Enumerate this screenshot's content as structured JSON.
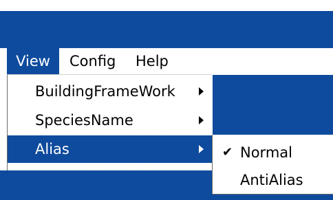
{
  "menubar": {
    "items": [
      {
        "label": "View",
        "active": true
      },
      {
        "label": "Config",
        "active": false
      },
      {
        "label": "Help",
        "active": false
      }
    ]
  },
  "view_menu": {
    "items": [
      {
        "label": "BuildingFrameWork",
        "has_submenu": true,
        "selected": false
      },
      {
        "label": "SpeciesName",
        "has_submenu": true,
        "selected": false
      },
      {
        "label": "Alias",
        "has_submenu": true,
        "selected": true
      }
    ]
  },
  "alias_submenu": {
    "items": [
      {
        "label": "Normal",
        "checked": true,
        "check_glyph": "✔"
      },
      {
        "label": "AntiAlias",
        "checked": false
      }
    ]
  },
  "colors": {
    "accent": "#0f4fa6",
    "menu_background": "#ffffff",
    "text": "#000000",
    "selected_text": "#ffffff"
  },
  "icons": {
    "submenu_arrow": "submenu-arrow-icon",
    "check": "checkmark-icon"
  }
}
